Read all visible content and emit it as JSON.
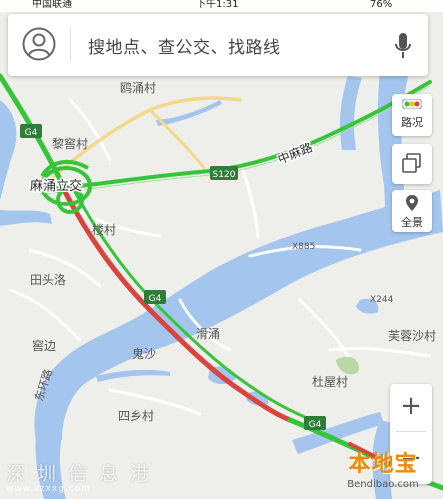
{
  "status_bar": {
    "carrier": "中国联通",
    "time": "下午1:31",
    "battery": "76%"
  },
  "search": {
    "placeholder": "搜地点、查公交、找路线"
  },
  "controls": {
    "traffic_label": "路况",
    "panorama_label": "全景",
    "zoom_in": "+",
    "zoom_out": "−"
  },
  "map": {
    "places": [
      {
        "id": "ouyongcun",
        "text": "鸥涌村"
      },
      {
        "id": "limuicun",
        "text": "黎窖村"
      },
      {
        "id": "machonglijiao",
        "text": "麻涌立交"
      },
      {
        "id": "loucun",
        "text": "楼村"
      },
      {
        "id": "tiantouluo",
        "text": "田头洛"
      },
      {
        "id": "kuobian",
        "text": "窖边"
      },
      {
        "id": "dongzhualu",
        "text": "东环路"
      },
      {
        "id": "guisha",
        "text": "鬼沙"
      },
      {
        "id": "huachong",
        "text": "滑涌"
      },
      {
        "id": "sixiangcun",
        "text": "四乡村"
      },
      {
        "id": "duwucun",
        "text": "杜屋村"
      },
      {
        "id": "furongshacun",
        "text": "芙蓉沙村"
      },
      {
        "id": "zhongmalu",
        "text": "中麻路"
      }
    ],
    "road_codes": {
      "g4": "G4",
      "s120": "S120",
      "x885": "X885",
      "x244": "X244"
    }
  },
  "watermarks": {
    "left_text": "深圳信息港",
    "left_url": "www.szxxg.com",
    "right_text": "本地宝",
    "right_url": "Bendibao.com"
  },
  "colors": {
    "land": "#eeeeea",
    "water": "#a3c5ee",
    "traffic_green": "#37c43a",
    "traffic_red": "#d9453e",
    "minor_road_yellow": "#f4d98a",
    "highway_shield": "#2f7d3a"
  }
}
